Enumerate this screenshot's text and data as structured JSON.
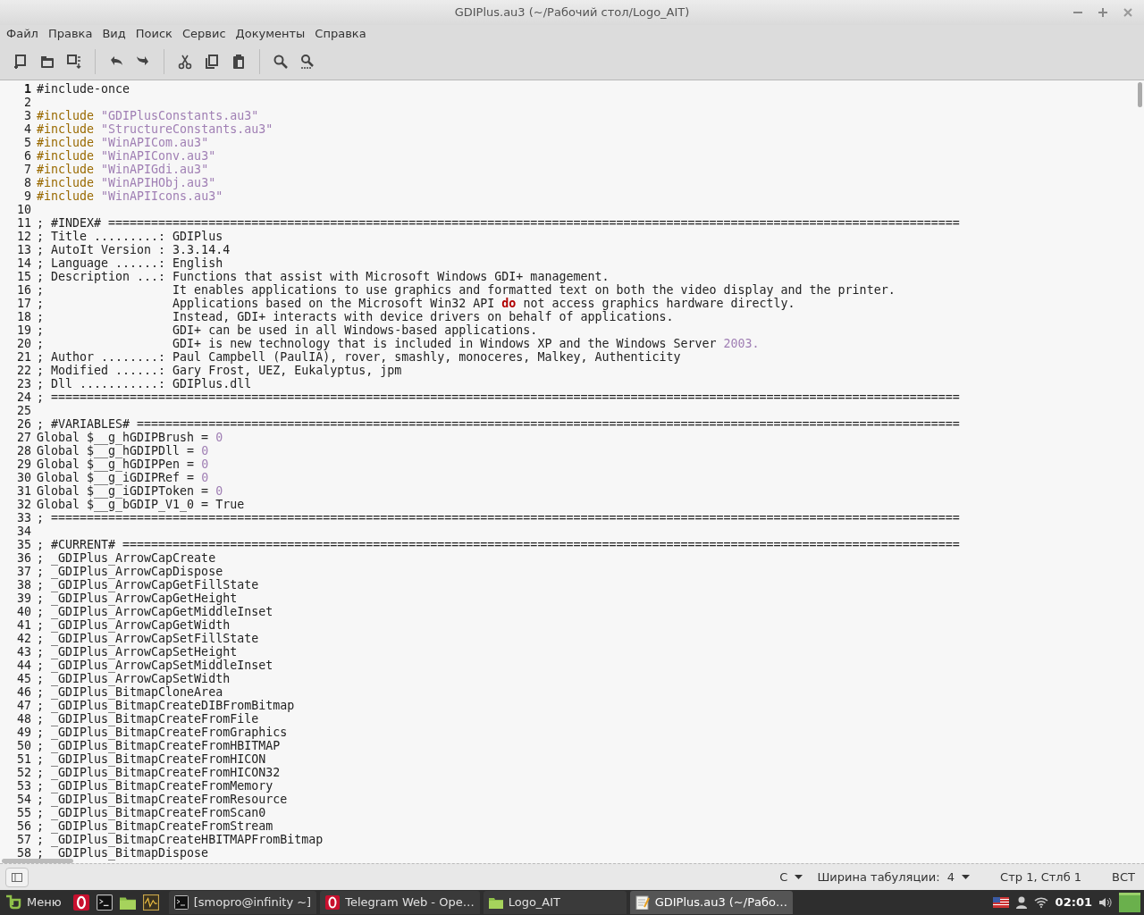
{
  "window": {
    "title": "GDIPlus.au3 (~/Рабочий стол/Logo_AIT)"
  },
  "menu": [
    "Файл",
    "Правка",
    "Вид",
    "Поиск",
    "Сервис",
    "Документы",
    "Справка"
  ],
  "toolbar": [
    {
      "kind": "new"
    },
    {
      "kind": "open"
    },
    {
      "kind": "save"
    },
    {
      "kind": "sep"
    },
    {
      "kind": "undo"
    },
    {
      "kind": "redo"
    },
    {
      "kind": "sep"
    },
    {
      "kind": "cut"
    },
    {
      "kind": "copy"
    },
    {
      "kind": "paste"
    },
    {
      "kind": "sep"
    },
    {
      "kind": "find"
    },
    {
      "kind": "replace"
    }
  ],
  "editor": {
    "lines": [
      {
        "n": "1",
        "current": true,
        "segments": [
          {
            "kind": "plain",
            "text": "#include-once"
          }
        ]
      },
      {
        "n": "2",
        "current": false
      },
      {
        "n": "3",
        "current": false,
        "segments": [
          {
            "kind": "keyword",
            "text": "#include"
          },
          {
            "kind": "string",
            "text": " \"GDIPlusConstants.au3\""
          }
        ]
      },
      {
        "n": "4",
        "current": false,
        "segments": [
          {
            "kind": "keyword",
            "text": "#include"
          },
          {
            "kind": "string",
            "text": " \"StructureConstants.au3\""
          }
        ]
      },
      {
        "n": "5",
        "current": false,
        "segments": [
          {
            "kind": "keyword",
            "text": "#include"
          },
          {
            "kind": "string",
            "text": " \"WinAPICom.au3\""
          }
        ]
      },
      {
        "n": "6",
        "current": false,
        "segments": [
          {
            "kind": "keyword",
            "text": "#include"
          },
          {
            "kind": "string",
            "text": " \"WinAPIConv.au3\""
          }
        ]
      },
      {
        "n": "7",
        "current": false,
        "segments": [
          {
            "kind": "keyword",
            "text": "#include"
          },
          {
            "kind": "string",
            "text": " \"WinAPIGdi.au3\""
          }
        ]
      },
      {
        "n": "8",
        "current": false,
        "segments": [
          {
            "kind": "keyword",
            "text": "#include"
          },
          {
            "kind": "string",
            "text": " \"WinAPIHObj.au3\""
          }
        ]
      },
      {
        "n": "9",
        "current": false,
        "segments": [
          {
            "kind": "keyword",
            "text": "#include"
          },
          {
            "kind": "string",
            "text": " \"WinAPIIcons.au3\""
          }
        ]
      },
      {
        "n": "10",
        "current": false
      },
      {
        "n": "11",
        "current": false,
        "segments": [
          {
            "kind": "plain",
            "text": "; #INDEX# ======================================================================================================================="
          }
        ]
      },
      {
        "n": "12",
        "current": false,
        "segments": [
          {
            "kind": "plain",
            "text": "; Title .........: GDIPlus"
          }
        ]
      },
      {
        "n": "13",
        "current": false,
        "segments": [
          {
            "kind": "plain",
            "text": "; AutoIt Version : 3.3.14.4"
          }
        ]
      },
      {
        "n": "14",
        "current": false,
        "segments": [
          {
            "kind": "plain",
            "text": "; Language ......: English"
          }
        ]
      },
      {
        "n": "15",
        "current": false,
        "segments": [
          {
            "kind": "plain",
            "text": "; Description ...: Functions that assist with Microsoft Windows GDI+ management."
          }
        ]
      },
      {
        "n": "16",
        "current": false,
        "segments": [
          {
            "kind": "plain",
            "text": ";                  It enables applications to use graphics and formatted text on both the video display and the printer."
          }
        ]
      },
      {
        "n": "17",
        "current": false,
        "segments": [
          {
            "kind": "plain",
            "text": ";                  Applications based on the Microsoft Win32 API "
          },
          {
            "kind": "bold",
            "text": "do"
          },
          {
            "kind": "plain",
            "text": " not access graphics hardware directly."
          }
        ]
      },
      {
        "n": "18",
        "current": false,
        "segments": [
          {
            "kind": "plain",
            "text": ";                  Instead, GDI+ interacts with device drivers on behalf of applications."
          }
        ]
      },
      {
        "n": "19",
        "current": false,
        "segments": [
          {
            "kind": "plain",
            "text": ";                  GDI+ can be used in all Windows-based applications."
          }
        ]
      },
      {
        "n": "20",
        "current": false,
        "segments": [
          {
            "kind": "plain",
            "text": ";                  GDI+ is new technology that is included in Windows XP and the Windows Server "
          },
          {
            "kind": "number",
            "text": "2003."
          }
        ]
      },
      {
        "n": "21",
        "current": false,
        "segments": [
          {
            "kind": "plain",
            "text": "; Author ........: Paul Campbell (PaulIA), rover, smashly, monoceres, Malkey, Authenticity"
          }
        ]
      },
      {
        "n": "22",
        "current": false,
        "segments": [
          {
            "kind": "plain",
            "text": "; Modified ......: Gary Frost, UEZ, Eukalyptus, jpm"
          }
        ]
      },
      {
        "n": "23",
        "current": false,
        "segments": [
          {
            "kind": "plain",
            "text": "; Dll ...........: GDIPlus.dll"
          }
        ]
      },
      {
        "n": "24",
        "current": false,
        "segments": [
          {
            "kind": "plain",
            "text": "; ==============================================================================================================================="
          }
        ]
      },
      {
        "n": "25",
        "current": false
      },
      {
        "n": "26",
        "current": false,
        "segments": [
          {
            "kind": "plain",
            "text": "; #VARIABLES# ==================================================================================================================="
          }
        ]
      },
      {
        "n": "27",
        "current": false,
        "segments": [
          {
            "kind": "plain",
            "text": "Global $__g_hGDIPBrush = "
          },
          {
            "kind": "number",
            "text": "0"
          }
        ]
      },
      {
        "n": "28",
        "current": false,
        "segments": [
          {
            "kind": "plain",
            "text": "Global $__g_hGDIPDll = "
          },
          {
            "kind": "number",
            "text": "0"
          }
        ]
      },
      {
        "n": "29",
        "current": false,
        "segments": [
          {
            "kind": "plain",
            "text": "Global $__g_hGDIPPen = "
          },
          {
            "kind": "number",
            "text": "0"
          }
        ]
      },
      {
        "n": "30",
        "current": false,
        "segments": [
          {
            "kind": "plain",
            "text": "Global $__g_iGDIPRef = "
          },
          {
            "kind": "number",
            "text": "0"
          }
        ]
      },
      {
        "n": "31",
        "current": false,
        "segments": [
          {
            "kind": "plain",
            "text": "Global $__g_iGDIPToken = "
          },
          {
            "kind": "number",
            "text": "0"
          }
        ]
      },
      {
        "n": "32",
        "current": false,
        "segments": [
          {
            "kind": "plain",
            "text": "Global $__g_bGDIP_V1_0 = True"
          }
        ]
      },
      {
        "n": "33",
        "current": false,
        "segments": [
          {
            "kind": "plain",
            "text": "; ==============================================================================================================================="
          }
        ]
      },
      {
        "n": "34",
        "current": false
      },
      {
        "n": "35",
        "current": false,
        "segments": [
          {
            "kind": "plain",
            "text": "; #CURRENT# ====================================================================================================================="
          }
        ]
      },
      {
        "n": "36",
        "current": false,
        "segments": [
          {
            "kind": "plain",
            "text": "; _GDIPlus_ArrowCapCreate"
          }
        ]
      },
      {
        "n": "37",
        "current": false,
        "segments": [
          {
            "kind": "plain",
            "text": "; _GDIPlus_ArrowCapDispose"
          }
        ]
      },
      {
        "n": "38",
        "current": false,
        "segments": [
          {
            "kind": "plain",
            "text": "; _GDIPlus_ArrowCapGetFillState"
          }
        ]
      },
      {
        "n": "39",
        "current": false,
        "segments": [
          {
            "kind": "plain",
            "text": "; _GDIPlus_ArrowCapGetHeight"
          }
        ]
      },
      {
        "n": "40",
        "current": false,
        "segments": [
          {
            "kind": "plain",
            "text": "; _GDIPlus_ArrowCapGetMiddleInset"
          }
        ]
      },
      {
        "n": "41",
        "current": false,
        "segments": [
          {
            "kind": "plain",
            "text": "; _GDIPlus_ArrowCapGetWidth"
          }
        ]
      },
      {
        "n": "42",
        "current": false,
        "segments": [
          {
            "kind": "plain",
            "text": "; _GDIPlus_ArrowCapSetFillState"
          }
        ]
      },
      {
        "n": "43",
        "current": false,
        "segments": [
          {
            "kind": "plain",
            "text": "; _GDIPlus_ArrowCapSetHeight"
          }
        ]
      },
      {
        "n": "44",
        "current": false,
        "segments": [
          {
            "kind": "plain",
            "text": "; _GDIPlus_ArrowCapSetMiddleInset"
          }
        ]
      },
      {
        "n": "45",
        "current": false,
        "segments": [
          {
            "kind": "plain",
            "text": "; _GDIPlus_ArrowCapSetWidth"
          }
        ]
      },
      {
        "n": "46",
        "current": false,
        "segments": [
          {
            "kind": "plain",
            "text": "; _GDIPlus_BitmapCloneArea"
          }
        ]
      },
      {
        "n": "47",
        "current": false,
        "segments": [
          {
            "kind": "plain",
            "text": "; _GDIPlus_BitmapCreateDIBFromBitmap"
          }
        ]
      },
      {
        "n": "48",
        "current": false,
        "segments": [
          {
            "kind": "plain",
            "text": "; _GDIPlus_BitmapCreateFromFile"
          }
        ]
      },
      {
        "n": "49",
        "current": false,
        "segments": [
          {
            "kind": "plain",
            "text": "; _GDIPlus_BitmapCreateFromGraphics"
          }
        ]
      },
      {
        "n": "50",
        "current": false,
        "segments": [
          {
            "kind": "plain",
            "text": "; _GDIPlus_BitmapCreateFromHBITMAP"
          }
        ]
      },
      {
        "n": "51",
        "current": false,
        "segments": [
          {
            "kind": "plain",
            "text": "; _GDIPlus_BitmapCreateFromHICON"
          }
        ]
      },
      {
        "n": "52",
        "current": false,
        "segments": [
          {
            "kind": "plain",
            "text": "; _GDIPlus_BitmapCreateFromHICON32"
          }
        ]
      },
      {
        "n": "53",
        "current": false,
        "segments": [
          {
            "kind": "plain",
            "text": "; _GDIPlus_BitmapCreateFromMemory"
          }
        ]
      },
      {
        "n": "54",
        "current": false,
        "segments": [
          {
            "kind": "plain",
            "text": "; _GDIPlus_BitmapCreateFromResource"
          }
        ]
      },
      {
        "n": "55",
        "current": false,
        "segments": [
          {
            "kind": "plain",
            "text": "; _GDIPlus_BitmapCreateFromScan0"
          }
        ]
      },
      {
        "n": "56",
        "current": false,
        "segments": [
          {
            "kind": "plain",
            "text": "; _GDIPlus_BitmapCreateFromStream"
          }
        ]
      },
      {
        "n": "57",
        "current": false,
        "segments": [
          {
            "kind": "plain",
            "text": "; _GDIPlus_BitmapCreateHBITMAPFromBitmap"
          }
        ]
      },
      {
        "n": "58",
        "current": false,
        "segments": [
          {
            "kind": "plain",
            "text": "; _GDIPlus_BitmapDispose"
          }
        ]
      }
    ]
  },
  "status_bar": {
    "encoding": "С",
    "tab_width": "Ширина табуляции:  4",
    "position": "Стр 1, Стлб 1",
    "mode": "ВСТ"
  },
  "taskbar": {
    "menu_label": "Меню",
    "launchers": [
      {
        "kind": "browser"
      },
      {
        "kind": "terminal"
      },
      {
        "kind": "folder"
      },
      {
        "kind": "monitor"
      }
    ],
    "windows": [
      {
        "kind": "terminal",
        "label": "[smopro@infinity ~]",
        "selected": false
      },
      {
        "kind": "browser",
        "label": "Telegram Web - Ope…",
        "selected": false
      },
      {
        "kind": "folder",
        "label": "Logo_AIT",
        "selected": false
      },
      {
        "kind": "editor",
        "label": "GDIPlus.au3 (~/Рабо…",
        "selected": true
      }
    ],
    "clock": "02:01"
  }
}
